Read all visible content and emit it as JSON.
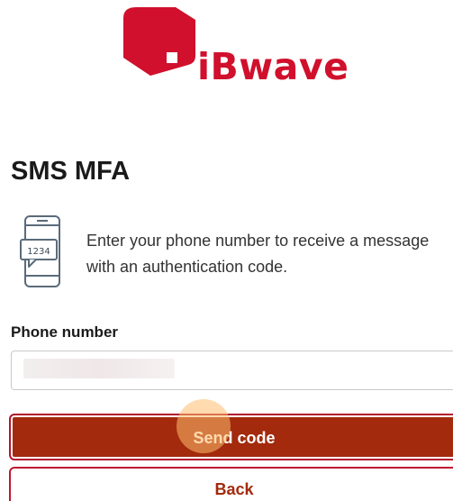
{
  "brand": {
    "logo_text": "iBwave",
    "accent_color": "#d0102c"
  },
  "page": {
    "title": "SMS MFA",
    "info_text": "Enter your phone number to receive a message with an authentication code.",
    "info_icon": "phone-sms-code-icon",
    "info_icon_code": "1234"
  },
  "form": {
    "phone_label": "Phone number",
    "phone_value": "",
    "send_label": "Send code",
    "back_label": "Back"
  },
  "colors": {
    "primary_button": "#a32a0d",
    "button_border": "#c01830"
  }
}
